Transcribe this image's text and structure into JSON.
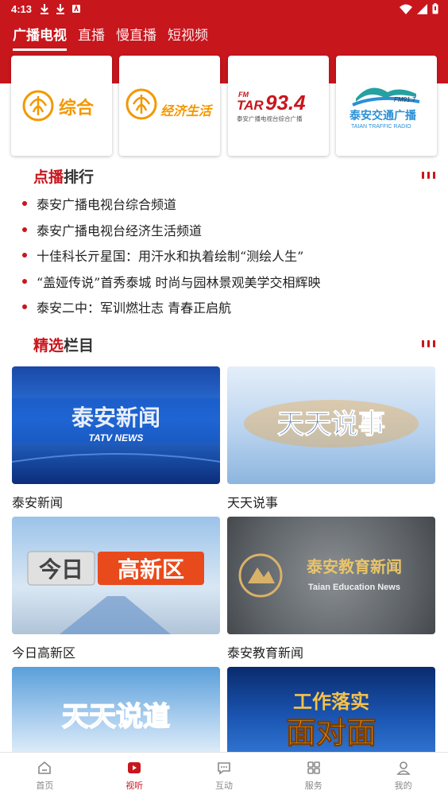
{
  "status": {
    "time": "4:13"
  },
  "tabs": [
    {
      "label": "广播电视",
      "active": true
    },
    {
      "label": "直播"
    },
    {
      "label": "慢直播"
    },
    {
      "label": "短视频"
    }
  ],
  "channels": [
    {
      "name": "综合",
      "icon": "taian-tv-logo"
    },
    {
      "name": "经济生活",
      "icon": "taian-tv-logo"
    },
    {
      "name": "93.4",
      "icon": "tar-radio-logo",
      "fm": "FM",
      "brand": "TAR",
      "sub": "泰安广播电视台综合广播"
    },
    {
      "name": "泰安交通广播",
      "icon": "traffic-radio-logo",
      "fm": "FM91.7",
      "sub": "TAIAN TRAFFIC RADIO"
    }
  ],
  "ranking": {
    "title_highlight": "点播",
    "title_rest": "排行",
    "items": [
      "泰安广播电视台综合频道",
      "泰安广播电视台经济生活频道",
      "十佳科长亓星国：用汗水和执着绘制“测绘人生”",
      "“盖娅传说”首秀泰城 时尚与园林景观美学交相辉映",
      "泰安二中：军训燃壮志 青春正启航"
    ]
  },
  "featured": {
    "title_highlight": "精选",
    "title_rest": "栏目",
    "programs": [
      {
        "label": "泰安新闻",
        "thumb_title": "泰安新闻",
        "thumb_sub": "TATV NEWS"
      },
      {
        "label": "天天说事",
        "thumb_title": "天天说事"
      },
      {
        "label": "今日高新区",
        "thumb_title_a": "今日",
        "thumb_title_b": "高新区"
      },
      {
        "label": "泰安教育新闻",
        "thumb_title": "泰安教育新闻",
        "thumb_sub": "Taian Education News"
      },
      {
        "thumb_title": "天天说道"
      },
      {
        "thumb_title_a": "工作落实",
        "thumb_title_b": "面对面"
      }
    ]
  },
  "bottom_nav": [
    {
      "label": "首页",
      "icon": "home-icon"
    },
    {
      "label": "视听",
      "icon": "play-icon",
      "active": true
    },
    {
      "label": "互动",
      "icon": "chat-icon"
    },
    {
      "label": "服务",
      "icon": "grid-icon"
    },
    {
      "label": "我的",
      "icon": "user-icon"
    }
  ],
  "colors": {
    "brand": "#c8161d",
    "logo_orange": "#f39800"
  }
}
